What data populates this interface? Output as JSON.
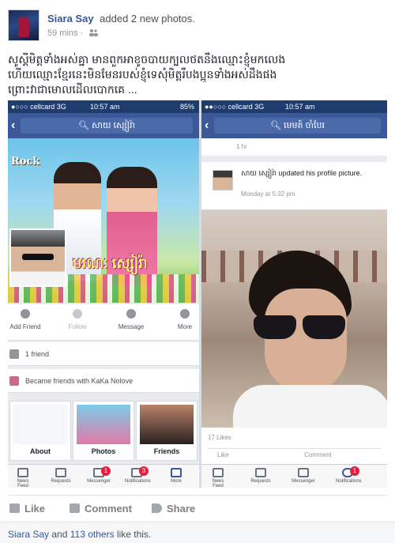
{
  "post": {
    "author": "Siara Say",
    "action": "added 2 new photos.",
    "time": "59 mins",
    "audience_icon": "friends-icon",
    "text_lines": [
      "សូស្តីមិត្តទាំងអស់គ្នា មានពួកអាខូចបាយក្បលថតនឹងឈ្មោះខ្ញុំមកលេង",
      "ហើយឈ្មោះខ្មែរនេះមិនមែនរបស់ខ្ញុំទេសុំមិត្តរឹបងប្អូនទាំងអស់ដឹងផង",
      "ព្រោះវាជាមោលដើលបោកគេ ..."
    ]
  },
  "left_phone": {
    "carrier": "●○○○ cellcard  3G",
    "time": "10:57 am",
    "battery": "85%",
    "search_text": "សាយ ស្សៀរ៉ា",
    "cover_logo": "Rock",
    "cover_title": "មរណៈ ស្សៀរ៉ា",
    "actions": [
      {
        "label": "Add Friend",
        "icon": "add-friend-icon"
      },
      {
        "label": "Follow",
        "icon": "follow-icon"
      },
      {
        "label": "Message",
        "icon": "message-icon"
      },
      {
        "label": "More",
        "icon": "more-icon"
      }
    ],
    "friends_count": "1 friend",
    "became_friends": "Became friends with KaKa Nolove",
    "tiles": [
      "About",
      "Photos",
      "Friends"
    ],
    "tabbar": [
      {
        "label": "News Feed",
        "badge": ""
      },
      {
        "label": "Requests",
        "badge": ""
      },
      {
        "label": "Messenger",
        "badge": "1"
      },
      {
        "label": "Notifications",
        "badge": "3"
      },
      {
        "label": "More",
        "badge": ""
      }
    ]
  },
  "right_phone": {
    "carrier": "●●○○○ cellcard  3G",
    "time": "10:57 am",
    "search_text": "មេមត៍ ចាំបែរ",
    "story_time": "1 hr",
    "update_author": "សាយ ស្សៀរ៉ា",
    "update_text": "updated his profile picture.",
    "update_time": "Monday at 5:32 pm",
    "likes": "17 Likes",
    "row_actions": [
      "Like",
      "Comment"
    ],
    "tabbar": [
      {
        "label": "News Feed",
        "badge": ""
      },
      {
        "label": "Requests",
        "badge": ""
      },
      {
        "label": "Messenger",
        "badge": ""
      },
      {
        "label": "Notifications",
        "badge": "1"
      }
    ]
  },
  "actions": {
    "like": "Like",
    "comment": "Comment",
    "share": "Share"
  },
  "likes_summary": {
    "name": "Siara Say",
    "and": "and",
    "others": "113 others",
    "suffix": "like this."
  },
  "colors": {
    "facebook_blue": "#3b5998",
    "link": "#365899",
    "badge_red": "#e41e3f"
  }
}
